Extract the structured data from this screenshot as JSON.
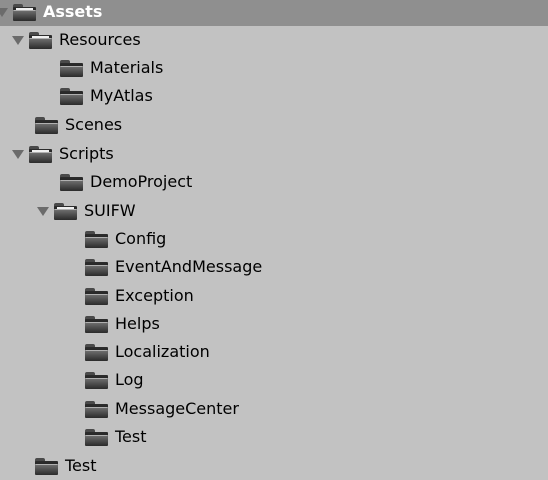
{
  "tree": {
    "assets": "Assets",
    "resources": "Resources",
    "materials": "Materials",
    "myatlas": "MyAtlas",
    "scenes": "Scenes",
    "scripts": "Scripts",
    "demoproject": "DemoProject",
    "suifw": "SUIFW",
    "config": "Config",
    "eventandmessage": "EventAndMessage",
    "exception": "Exception",
    "helps": "Helps",
    "localization": "Localization",
    "log": "Log",
    "messagecenter": "MessageCenter",
    "suifw_test": "Test",
    "test": "Test"
  },
  "icons": {
    "expanded": "triangle-down",
    "folder_open": "folder-open-icon",
    "folder_closed": "folder-icon"
  },
  "colors": {
    "background": "#c2c2c2",
    "selected_row": "#8f8f8f",
    "selected_text": "#ffffff"
  }
}
